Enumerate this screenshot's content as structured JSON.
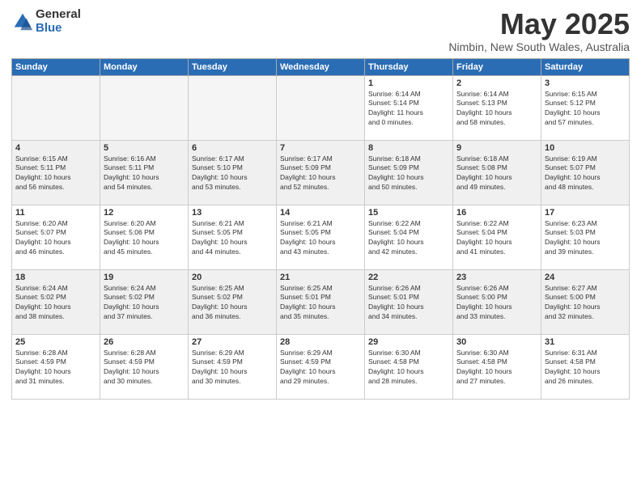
{
  "logo": {
    "general": "General",
    "blue": "Blue"
  },
  "title": "May 2025",
  "subtitle": "Nimbin, New South Wales, Australia",
  "weekdays": [
    "Sunday",
    "Monday",
    "Tuesday",
    "Wednesday",
    "Thursday",
    "Friday",
    "Saturday"
  ],
  "rows": [
    [
      {
        "day": "",
        "info": ""
      },
      {
        "day": "",
        "info": ""
      },
      {
        "day": "",
        "info": ""
      },
      {
        "day": "",
        "info": ""
      },
      {
        "day": "1",
        "info": "Sunrise: 6:14 AM\nSunset: 5:14 PM\nDaylight: 11 hours\nand 0 minutes."
      },
      {
        "day": "2",
        "info": "Sunrise: 6:14 AM\nSunset: 5:13 PM\nDaylight: 10 hours\nand 58 minutes."
      },
      {
        "day": "3",
        "info": "Sunrise: 6:15 AM\nSunset: 5:12 PM\nDaylight: 10 hours\nand 57 minutes."
      }
    ],
    [
      {
        "day": "4",
        "info": "Sunrise: 6:15 AM\nSunset: 5:11 PM\nDaylight: 10 hours\nand 56 minutes."
      },
      {
        "day": "5",
        "info": "Sunrise: 6:16 AM\nSunset: 5:11 PM\nDaylight: 10 hours\nand 54 minutes."
      },
      {
        "day": "6",
        "info": "Sunrise: 6:17 AM\nSunset: 5:10 PM\nDaylight: 10 hours\nand 53 minutes."
      },
      {
        "day": "7",
        "info": "Sunrise: 6:17 AM\nSunset: 5:09 PM\nDaylight: 10 hours\nand 52 minutes."
      },
      {
        "day": "8",
        "info": "Sunrise: 6:18 AM\nSunset: 5:09 PM\nDaylight: 10 hours\nand 50 minutes."
      },
      {
        "day": "9",
        "info": "Sunrise: 6:18 AM\nSunset: 5:08 PM\nDaylight: 10 hours\nand 49 minutes."
      },
      {
        "day": "10",
        "info": "Sunrise: 6:19 AM\nSunset: 5:07 PM\nDaylight: 10 hours\nand 48 minutes."
      }
    ],
    [
      {
        "day": "11",
        "info": "Sunrise: 6:20 AM\nSunset: 5:07 PM\nDaylight: 10 hours\nand 46 minutes."
      },
      {
        "day": "12",
        "info": "Sunrise: 6:20 AM\nSunset: 5:06 PM\nDaylight: 10 hours\nand 45 minutes."
      },
      {
        "day": "13",
        "info": "Sunrise: 6:21 AM\nSunset: 5:05 PM\nDaylight: 10 hours\nand 44 minutes."
      },
      {
        "day": "14",
        "info": "Sunrise: 6:21 AM\nSunset: 5:05 PM\nDaylight: 10 hours\nand 43 minutes."
      },
      {
        "day": "15",
        "info": "Sunrise: 6:22 AM\nSunset: 5:04 PM\nDaylight: 10 hours\nand 42 minutes."
      },
      {
        "day": "16",
        "info": "Sunrise: 6:22 AM\nSunset: 5:04 PM\nDaylight: 10 hours\nand 41 minutes."
      },
      {
        "day": "17",
        "info": "Sunrise: 6:23 AM\nSunset: 5:03 PM\nDaylight: 10 hours\nand 39 minutes."
      }
    ],
    [
      {
        "day": "18",
        "info": "Sunrise: 6:24 AM\nSunset: 5:02 PM\nDaylight: 10 hours\nand 38 minutes."
      },
      {
        "day": "19",
        "info": "Sunrise: 6:24 AM\nSunset: 5:02 PM\nDaylight: 10 hours\nand 37 minutes."
      },
      {
        "day": "20",
        "info": "Sunrise: 6:25 AM\nSunset: 5:02 PM\nDaylight: 10 hours\nand 36 minutes."
      },
      {
        "day": "21",
        "info": "Sunrise: 6:25 AM\nSunset: 5:01 PM\nDaylight: 10 hours\nand 35 minutes."
      },
      {
        "day": "22",
        "info": "Sunrise: 6:26 AM\nSunset: 5:01 PM\nDaylight: 10 hours\nand 34 minutes."
      },
      {
        "day": "23",
        "info": "Sunrise: 6:26 AM\nSunset: 5:00 PM\nDaylight: 10 hours\nand 33 minutes."
      },
      {
        "day": "24",
        "info": "Sunrise: 6:27 AM\nSunset: 5:00 PM\nDaylight: 10 hours\nand 32 minutes."
      }
    ],
    [
      {
        "day": "25",
        "info": "Sunrise: 6:28 AM\nSunset: 4:59 PM\nDaylight: 10 hours\nand 31 minutes."
      },
      {
        "day": "26",
        "info": "Sunrise: 6:28 AM\nSunset: 4:59 PM\nDaylight: 10 hours\nand 30 minutes."
      },
      {
        "day": "27",
        "info": "Sunrise: 6:29 AM\nSunset: 4:59 PM\nDaylight: 10 hours\nand 30 minutes."
      },
      {
        "day": "28",
        "info": "Sunrise: 6:29 AM\nSunset: 4:59 PM\nDaylight: 10 hours\nand 29 minutes."
      },
      {
        "day": "29",
        "info": "Sunrise: 6:30 AM\nSunset: 4:58 PM\nDaylight: 10 hours\nand 28 minutes."
      },
      {
        "day": "30",
        "info": "Sunrise: 6:30 AM\nSunset: 4:58 PM\nDaylight: 10 hours\nand 27 minutes."
      },
      {
        "day": "31",
        "info": "Sunrise: 6:31 AM\nSunset: 4:58 PM\nDaylight: 10 hours\nand 26 minutes."
      }
    ]
  ]
}
